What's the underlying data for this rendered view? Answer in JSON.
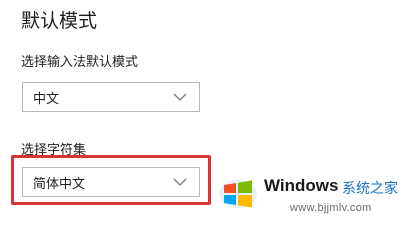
{
  "section": {
    "title": "默认模式"
  },
  "input_mode": {
    "label": "选择输入法默认模式",
    "selected": "中文"
  },
  "charset": {
    "label": "选择字符集",
    "selected": "简体中文"
  },
  "watermark": {
    "brand": "Windows",
    "site_name": "系统之家",
    "url": "www.bjjmlv.com"
  },
  "colors": {
    "highlight": "#d93434",
    "select_border": "#b9b9b9",
    "watermark_accent": "#1a6fc4"
  },
  "icons": {
    "dropdown": "chevron-down-icon",
    "logo": "windows-logo-icon"
  }
}
